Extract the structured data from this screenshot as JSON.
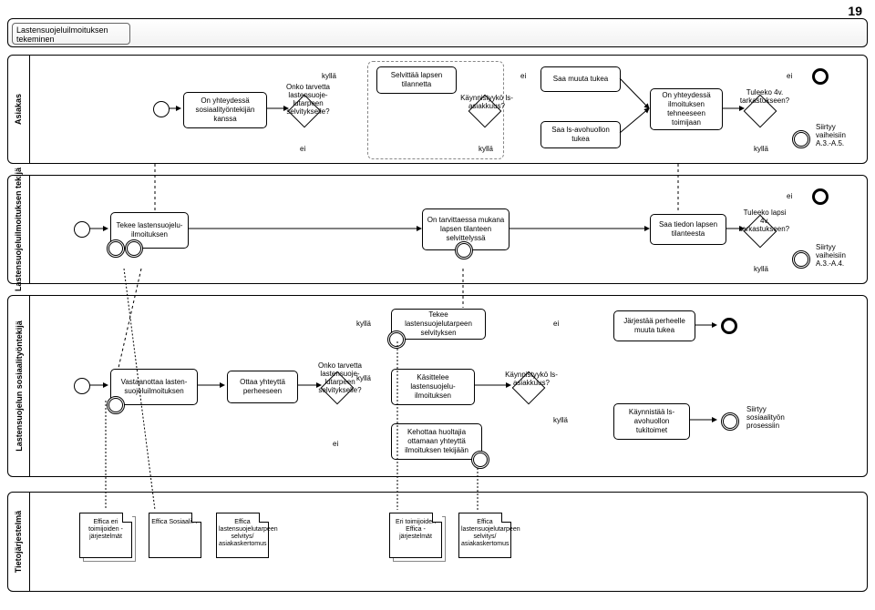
{
  "page_number": "19",
  "process_title": "Lastensuojeluilmoituksen tekeminen",
  "lanes": {
    "asiakas": {
      "label": "Asiakas",
      "task1": "On yhteydessä sosiaalityöntekijän kanssa",
      "gw1_label": "Onko tarvetta lastensuoje-lutarpeen selvitykselle?",
      "task2": "Selvittää lapsen tilannetta",
      "gw2_label": "Käynnistyykö ls-asiakkuus?",
      "task3a": "Saa muuta tukea",
      "task3b": "Saa ls-avohuollon tukea",
      "task4": "On yhteydessä ilmoituksen tehneeseen toimijaan",
      "gw3_label": "Tuleeko 4v. tarkastukseen?",
      "end_label": "Siirtyy vaiheisiin A.3.-A.5.",
      "kylla": "kyllä",
      "ei": "ei"
    },
    "tekija": {
      "label": "Lastensuojeluilmoituksen tekijä",
      "task1": "Tekee lastensuojelu-ilmoituksen",
      "task2": "On tarvittaessa mukana lapsen tilanteen selvittelyssä",
      "task3": "Saa tiedon lapsen tilanteesta",
      "gw_label": "Tuleeko lapsi 4v. tarkastukseen?",
      "end_label": "Siirtyy vaiheisiin A.3.-A.4.",
      "kylla": "kyllä",
      "ei": "ei"
    },
    "sosiaali": {
      "label": "Lastensuojelun sosiaalityöntekijä",
      "task1": "Vastaanottaa lasten-suojeluilmoituksen",
      "task2": "Ottaa yhteyttä perheeseen",
      "gw1_label": "Onko tarvetta lastensuoje-lutarpeen selvitykselle?",
      "task3a": "Tekee lastensuojelutarpeen selvityksen",
      "task3b": "Käsittelee lastensuojelu-ilmoituksen",
      "task3c": "Kehottaa huoltajia ottamaan yhteyttä ilmoituksen tekijään",
      "gw2_label": "Käynnistyykö ls-asiakkuus?",
      "task4a": "Järjestää perheelle muuta tukea",
      "task4b": "Käynnistää ls-avohuollon tukitoimet",
      "end_label": "Siirtyy sosiaalityön prosessiin",
      "kylla": "kyllä",
      "ei": "ei"
    },
    "tieto": {
      "label": "Tietojärjestelmä",
      "doc1": "Effica eri toimijoiden -järjestelmät",
      "doc2": "Effica Sosiaali??",
      "doc3": "Effica lastensuojelutarpeen selvitys/ asiakaskertomus",
      "doc4": "Eri toimijoiden Effica -järjestelmät",
      "doc5": "Effica lastensuojelutarpeen selvitys/ asiakaskertomus"
    }
  },
  "chart_data": {
    "type": "bpmn-diagram",
    "title": "Lastensuojeluilmoituksen tekeminen",
    "pool": "Lastensuojeluilmoituksen tekeminen",
    "lanes": [
      "Asiakas",
      "Lastensuojeluilmoituksen tekijä",
      "Lastensuojelun sosiaalityöntekijä",
      "Tietojärjestelmä"
    ],
    "nodes": [
      {
        "id": "a_start",
        "lane": "Asiakas",
        "type": "start"
      },
      {
        "id": "a_t1",
        "lane": "Asiakas",
        "type": "task",
        "label": "On yhteydessä sosiaalityöntekijän kanssa"
      },
      {
        "id": "a_gw1",
        "lane": "Asiakas",
        "type": "gateway",
        "label": "Onko tarvetta lastensuojelutarpeen selvitykselle?"
      },
      {
        "id": "a_t2",
        "lane": "Asiakas",
        "type": "task",
        "label": "Selvittää lapsen tilannetta"
      },
      {
        "id": "a_gw2",
        "lane": "Asiakas",
        "type": "gateway",
        "label": "Käynnistyykö ls-asiakkuus?"
      },
      {
        "id": "a_t3a",
        "lane": "Asiakas",
        "type": "task",
        "label": "Saa muuta tukea"
      },
      {
        "id": "a_t3b",
        "lane": "Asiakas",
        "type": "task",
        "label": "Saa ls-avohuollon tukea"
      },
      {
        "id": "a_t4",
        "lane": "Asiakas",
        "type": "task",
        "label": "On yhteydessä ilmoituksen tehneeseen toimijaan"
      },
      {
        "id": "a_gw3",
        "lane": "Asiakas",
        "type": "gateway",
        "label": "Tuleeko 4v. tarkastukseen?"
      },
      {
        "id": "a_int",
        "lane": "Asiakas",
        "type": "intermediate",
        "label": "Siirtyy vaiheisiin A.3.-A.5."
      },
      {
        "id": "a_end",
        "lane": "Asiakas",
        "type": "end"
      },
      {
        "id": "t_start",
        "lane": "Tekijä",
        "type": "start"
      },
      {
        "id": "t_t1",
        "lane": "Tekijä",
        "type": "task",
        "label": "Tekee lastensuojeluilmoituksen"
      },
      {
        "id": "t_t2",
        "lane": "Tekijä",
        "type": "task",
        "label": "On tarvittaessa mukana lapsen tilanteen selvittelyssä"
      },
      {
        "id": "t_t3",
        "lane": "Tekijä",
        "type": "task",
        "label": "Saa tiedon lapsen tilanteesta"
      },
      {
        "id": "t_gw",
        "lane": "Tekijä",
        "type": "gateway",
        "label": "Tuleeko lapsi 4v. tarkastukseen?"
      },
      {
        "id": "t_int",
        "lane": "Tekijä",
        "type": "intermediate",
        "label": "Siirtyy vaiheisiin A.3.-A.4."
      },
      {
        "id": "t_end",
        "lane": "Tekijä",
        "type": "end"
      },
      {
        "id": "s_start",
        "lane": "Sosiaali",
        "type": "start"
      },
      {
        "id": "s_t1",
        "lane": "Sosiaali",
        "type": "task",
        "label": "Vastaanottaa lastensuojeluilmoituksen"
      },
      {
        "id": "s_t2",
        "lane": "Sosiaali",
        "type": "task",
        "label": "Ottaa yhteyttä perheeseen"
      },
      {
        "id": "s_gw1",
        "lane": "Sosiaali",
        "type": "gateway",
        "label": "Onko tarvetta lastensuojelutarpeen selvitykselle?"
      },
      {
        "id": "s_t3a",
        "lane": "Sosiaali",
        "type": "task",
        "label": "Tekee lastensuojelutarpeen selvityksen"
      },
      {
        "id": "s_t3b",
        "lane": "Sosiaali",
        "type": "task",
        "label": "Käsittelee lastensuojeluilmoituksen"
      },
      {
        "id": "s_t3c",
        "lane": "Sosiaali",
        "type": "task",
        "label": "Kehottaa huoltajia ottamaan yhteyttä ilmoituksen tekijään"
      },
      {
        "id": "s_gw2",
        "lane": "Sosiaali",
        "type": "gateway",
        "label": "Käynnistyykö ls-asiakkuus?"
      },
      {
        "id": "s_t4a",
        "lane": "Sosiaali",
        "type": "task",
        "label": "Järjestää perheelle muuta tukea"
      },
      {
        "id": "s_t4b",
        "lane": "Sosiaali",
        "type": "task",
        "label": "Käynnistää ls-avohuollon tukitoimet"
      },
      {
        "id": "s_int",
        "lane": "Sosiaali",
        "type": "intermediate",
        "label": "Siirtyy sosiaalityön prosessiin"
      },
      {
        "id": "s_end",
        "lane": "Sosiaali",
        "type": "end"
      }
    ],
    "flows": [
      {
        "from": "a_start",
        "to": "a_t1"
      },
      {
        "from": "a_t1",
        "to": "a_gw1"
      },
      {
        "from": "a_gw1",
        "to": "a_t2",
        "label": "kyllä"
      },
      {
        "from": "a_gw1",
        "to": "a_end",
        "label": "ei"
      },
      {
        "from": "a_t2",
        "to": "a_gw2"
      },
      {
        "from": "a_gw2",
        "to": "a_t3a",
        "label": "ei"
      },
      {
        "from": "a_gw2",
        "to": "a_t3b",
        "label": "kyllä"
      },
      {
        "from": "a_t3a",
        "to": "a_t4"
      },
      {
        "from": "a_t3b",
        "to": "a_t4"
      },
      {
        "from": "a_t4",
        "to": "a_gw3"
      },
      {
        "from": "a_gw3",
        "to": "a_int",
        "label": "kyllä"
      },
      {
        "from": "a_gw3",
        "to": "a_end",
        "label": "ei"
      },
      {
        "from": "t_start",
        "to": "t_t1"
      },
      {
        "from": "t_t1",
        "to": "t_t2"
      },
      {
        "from": "t_t2",
        "to": "t_t3"
      },
      {
        "from": "t_t3",
        "to": "t_gw"
      },
      {
        "from": "t_gw",
        "to": "t_int",
        "label": "kyllä"
      },
      {
        "from": "t_gw",
        "to": "t_end",
        "label": "ei"
      },
      {
        "from": "s_start",
        "to": "s_t1"
      },
      {
        "from": "s_t1",
        "to": "s_t2"
      },
      {
        "from": "s_t2",
        "to": "s_gw1"
      },
      {
        "from": "s_gw1",
        "to": "s_t3a",
        "label": "kyllä"
      },
      {
        "from": "s_gw1",
        "to": "s_t3b",
        "label": "kyllä"
      },
      {
        "from": "s_gw1",
        "to": "s_t3c",
        "label": "ei"
      },
      {
        "from": "s_t3b",
        "to": "s_gw2"
      },
      {
        "from": "s_gw2",
        "to": "s_t4a",
        "label": "ei"
      },
      {
        "from": "s_gw2",
        "to": "s_t4b",
        "label": "kyllä"
      },
      {
        "from": "s_t4a",
        "to": "s_end"
      },
      {
        "from": "s_t4b",
        "to": "s_int"
      }
    ],
    "data_objects": [
      {
        "lane": "Tietojärjestelmä",
        "label": "Effica eri toimijoiden -järjestelmät"
      },
      {
        "lane": "Tietojärjestelmä",
        "label": "Effica Sosiaali??"
      },
      {
        "lane": "Tietojärjestelmä",
        "label": "Effica lastensuojelutarpeen selvitys/ asiakaskertomus"
      },
      {
        "lane": "Tietojärjestelmä",
        "label": "Eri toimijoiden Effica -järjestelmät"
      },
      {
        "lane": "Tietojärjestelmä",
        "label": "Effica lastensuojelutarpeen selvitys/ asiakaskertomus"
      }
    ]
  }
}
